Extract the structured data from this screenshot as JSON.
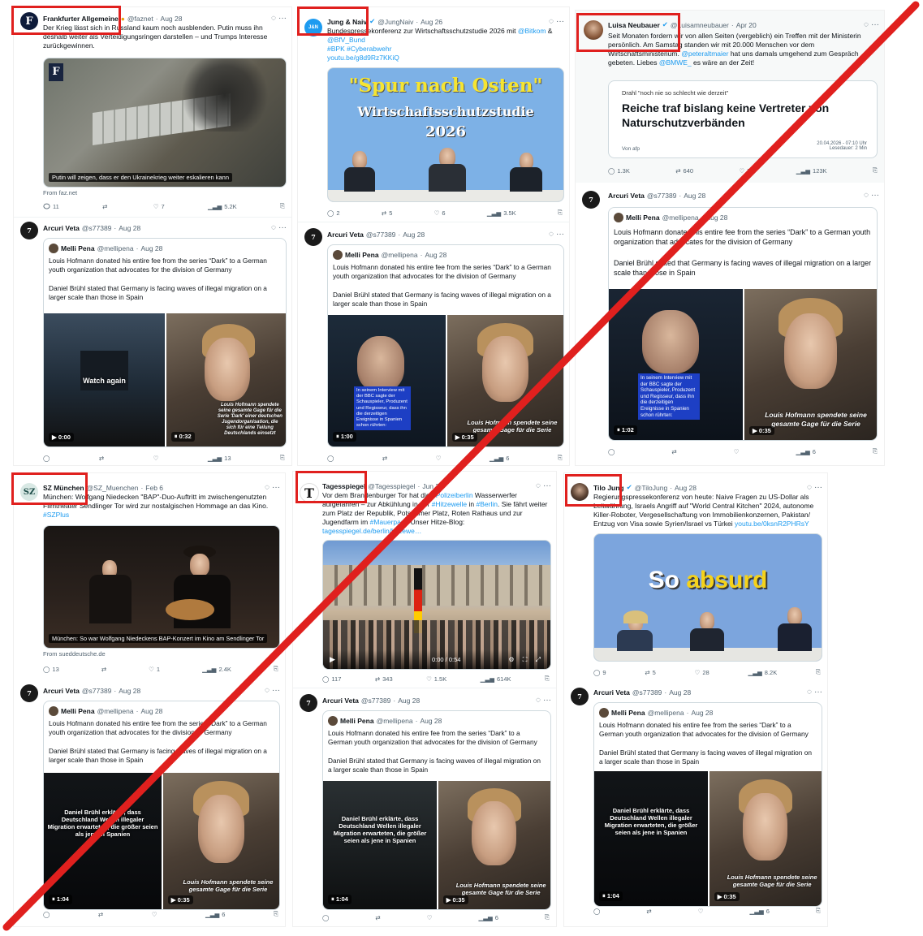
{
  "colors": {
    "accent": "#1d9bf0",
    "redbox": "#e0201e",
    "slash": "#e0201e",
    "verified": "#1d9bf0"
  },
  "reply_tweet": {
    "author": "Arcuri Veta",
    "handle": "@s77389",
    "date": "Aug 28",
    "quote": {
      "author": "Melli Pena",
      "handle": "@mellipena",
      "date": "Aug 28",
      "p1": "Louis Hofmann donated his entire fee from the series “Dark” to a German youth organization that advocates for the division of Germany",
      "p2": "Daniel Brühl stated that Germany is facing waves of illegal migration on a larger scale than those in Spain",
      "cap_right": "Louis Hofmann spendete seine gesamte Gage für die Serie",
      "cap_right_small": "Louis Hofmann spendete seine gesamte Gage für die Serie 'Dark' einer deutschen Jugendorganisation, die sich für eine Teilung Deutschlands einsetzt",
      "cap_left_brühl": "Daniel Brühl erklärte, dass Deutschland Wellen illegaler Migration erwarteten, die größer seien als jene in Spanien",
      "bluebox": "In seinem Interview mit der BBC sagte der Schauspieler, Produzent und Regisseur, dass ihn die derzeitigen Ereignisse in Spanien schon rührten:",
      "watch_again": "Watch again"
    }
  },
  "cells": [
    {
      "author": "Frankfurter Allgemeine",
      "handle": "@faznet",
      "date": "Aug 28",
      "text": "Der Krieg lässt sich in Russland kaum noch ausblenden. Putin muss ihn deshalb weiter als Verteidigungsringen darstellen – und Trumps Interesse zurückgewinnen.",
      "media_caption": "Putin will zeigen, dass er den Ukrainekrieg weiter eskalieren kann",
      "source": "From faz.net",
      "stats": {
        "replies": "11",
        "retweets": "",
        "likes": "7",
        "views": "5.2K"
      },
      "reply_stats": {
        "replies": "",
        "retweets": "",
        "likes": "",
        "views": "13"
      },
      "time_l": "0:00",
      "time_r": "0:32"
    },
    {
      "author": "Jung & Naiv",
      "handle": "@JungNaiv",
      "date": "Aug 26",
      "text_pre": "Bundespressekonferenz zur Wirtschaftsschutzstudie 2026 mit ",
      "text_links": [
        "@Bitkom",
        "@BfV_Bund",
        "#BPK",
        "#Cyberabwehr",
        "youtu.be/g8d9Rz7KKiQ"
      ],
      "banner_1": "\"Spur nach Osten\"",
      "banner_2": "Wirtschaftsschutzstudie",
      "banner_3": "2026",
      "stats": {
        "replies": "2",
        "retweets": "5",
        "likes": "6",
        "views": "3.5K"
      },
      "reply_stats": {
        "views": "6"
      },
      "time_l": "1:00",
      "time_r": "0:35"
    },
    {
      "author": "Luisa Neubauer",
      "handle": "@Luisamneubauer",
      "date": "Apr 20",
      "text_pre": "Seit Monaten fordern wir von allen Seiten (vergeblich) ein Treffen mit der Ministerin persönlich. Am Samstag standen wir mit 20.000 Menschen vor dem Wirtschaftsministerium. ",
      "text_link1": "@peteraltmaier",
      "text_mid": " hat uns damals umgehend zum Gespräch gebeten. Liebes ",
      "text_link2": "@BMWE_",
      "text_post": " es wäre an der Zeit!",
      "article_kicker": "Drahl \"noch nie so schlecht wie derzeit\"",
      "article_title": "Reiche traf bislang keine Vertreter von Naturschutzverbänden",
      "article_by": "Von afp",
      "article_date": "20.04.2026 - 07:10 Uhr",
      "article_read": "Lesedauer: 2 Min",
      "stats": {
        "replies": "1.3K",
        "retweets": "640",
        "likes": "3",
        "views": "123K"
      },
      "reply_stats": {
        "views": "6"
      },
      "time_l": "1:02",
      "time_r": "0:35"
    },
    {
      "author": "SZ München",
      "handle": "@SZ_Muenchen",
      "date": "Feb 6",
      "text": "München: Wolfgang Niedecken \"BAP\"-Duo-Auftritt im zwischengenutzten Filmtheater Sendlinger Tor wird zur nostalgischen Hommage an das Kino. ",
      "text_link": "#SZPlus",
      "media_caption": "München: So war Wolfgang Niedeckens BAP-Konzert im Kino am Sendlinger Tor",
      "source": "From sueddeutsche.de",
      "stats": {
        "replies": "13",
        "retweets": "",
        "likes": "1",
        "views": "2.4K"
      },
      "reply_stats": {
        "views": "6"
      },
      "time_l": "1:04",
      "time_r": "0:35"
    },
    {
      "author": "Tagesspiegel",
      "handle": "@Tagesspiegel",
      "date": "Jun 27",
      "text_pre": "Vor dem Brandenburger Tor hat die ",
      "text_link1": "#Polizeiberlin",
      "text_mid1": " Wasserwerfer aufgefahren – zur Abkühlung in der ",
      "text_link2": "#Hitzewelle",
      "text_mid2": " in ",
      "text_link3": "#Berlin",
      "text_mid3": ". Sie fährt weiter zum Platz der Republik, Potsdamer Platz, Roten Rathaus und zur Jugendfarm im ",
      "text_link4": "#Mauerpark",
      "text_mid4": ". Unser Hitze-Blog: ",
      "text_link5": "tagesspiegel.de/berlin/hitzewe…",
      "video_time": "0:00 / 0:54",
      "stats": {
        "replies": "117",
        "retweets": "343",
        "likes": "1.5K",
        "views": "614K"
      },
      "reply_stats": {
        "views": "6"
      },
      "time_l": "1:04",
      "time_r": "0:35"
    },
    {
      "author": "Tilo Jung",
      "handle": "@TiloJung",
      "date": "Aug 28",
      "text": "Regierungspressekonferenz von heute: Naive Fragen zu US-Dollar als Leitwährung, Israels Angriff auf \"World Central Kitchen\" 2024, autonome Killer-Roboter, Vergesellschaftung von Immobilienkonzernen, Pakistan/ Entzug von Visa sowie Syrien/Israel vs Türkei ",
      "text_link": "youtu.be/0ksnR2PHRsY",
      "banner_1": "So",
      "banner_2": "absurd",
      "stats": {
        "replies": "9",
        "retweets": "5",
        "likes": "28",
        "views": "8.2K"
      },
      "reply_stats": {
        "views": "6"
      },
      "time_l": "1:04",
      "time_r": "0:35"
    }
  ]
}
